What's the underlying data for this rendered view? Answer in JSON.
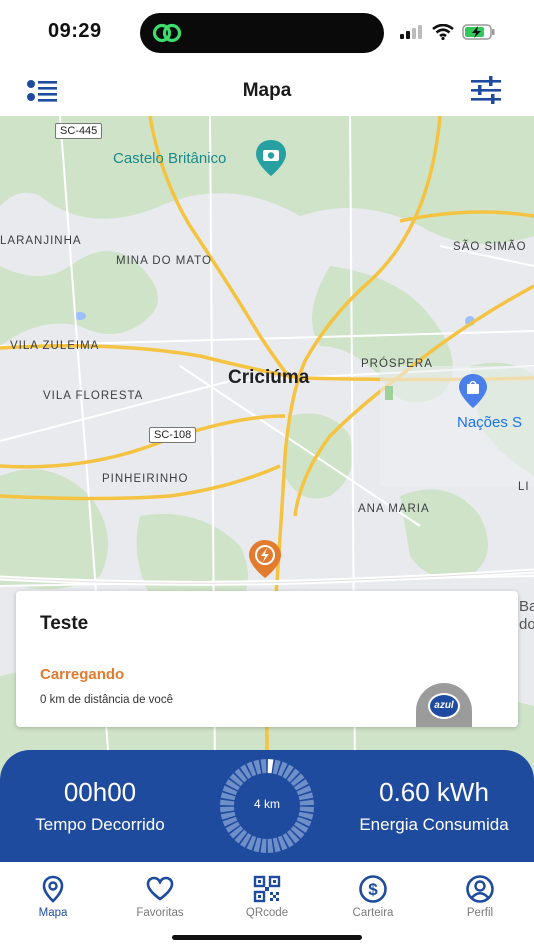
{
  "status_bar": {
    "time": "09:29"
  },
  "header": {
    "title": "Mapa",
    "menu_icon": "list-icon",
    "filter_icon": "sliders-icon"
  },
  "map": {
    "labels": {
      "sc445": "SC-445",
      "castelo": "Castelo Britânico",
      "laranjinha": "LARANJINHA",
      "mina": "MINA DO MATO",
      "sao_simao": "SÃO SIMÃO",
      "vila_zuleima": "VILA ZULEIMA",
      "criciuma": "Criciúma",
      "prospera": "PRÓSPERA",
      "vila_floresta": "VILA FLORESTA",
      "nacoes": "Nações S",
      "sc108": "SC-108",
      "pinheirinho": "PINHEIRINHO",
      "ana_maria": "ANA MARIA",
      "edge_li": "LI",
      "edge_ba": "Ba",
      "edge_do": "do"
    },
    "colors": {
      "road": "#f5c342",
      "green": "#cfe3c8",
      "base": "#e8eaed",
      "marker": "#e27b2e"
    }
  },
  "station_card": {
    "title": "Teste",
    "status": "Carregando",
    "distance": "0 km de distância de você",
    "brand": "azul"
  },
  "charging_panel": {
    "elapsed_value": "00h00",
    "elapsed_label": "Tempo Decorrido",
    "gauge_text": "4 km",
    "energy_value": "0.60 kWh",
    "energy_label": "Energia Consumida",
    "background": "#1f4b9f"
  },
  "bottom_nav": {
    "items": [
      {
        "label": "Mapa",
        "icon": "map-pin-icon",
        "active": true
      },
      {
        "label": "Favoritas",
        "icon": "heart-icon",
        "active": false
      },
      {
        "label": "QRcode",
        "icon": "qrcode-icon",
        "active": false
      },
      {
        "label": "Carteira",
        "icon": "dollar-icon",
        "active": false
      },
      {
        "label": "Perfil",
        "icon": "user-icon",
        "active": false
      }
    ]
  }
}
